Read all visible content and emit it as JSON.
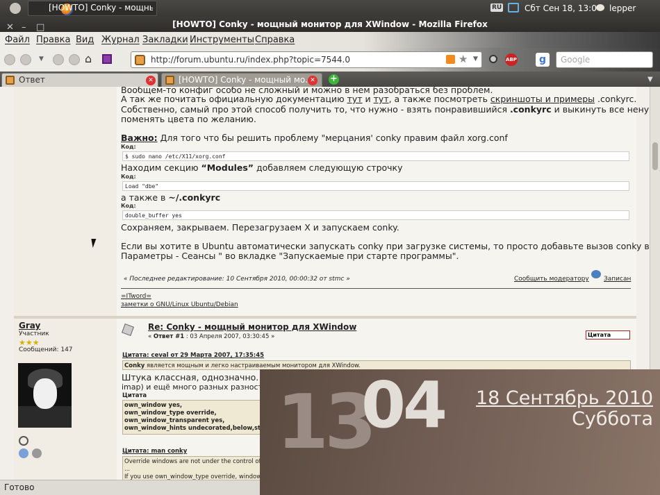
{
  "panel": {
    "task_title": "[HOWTO] Conky - мощны...",
    "keyboard": "RU",
    "clock": "Сбт Сен 18, 13:04",
    "user": "lepper"
  },
  "window": {
    "title": "[HOWTO] Conky - мощный монитор для XWindow - Mozilla Firefox"
  },
  "menu": [
    "Файл",
    "Правка",
    "Вид",
    "Журнал",
    "Закладки",
    "Инструменты",
    "Справка"
  ],
  "nav": {
    "url": "http://forum.ubuntu.ru/index.php?topic=7544.0",
    "search_placeholder": "Google",
    "abp": "ABP"
  },
  "tabs": [
    {
      "label": "Ответ"
    },
    {
      "label": "[HOWTO] Conky - мощный мо..."
    }
  ],
  "post1": {
    "line1": "Вообщем-то конфиг особо не сложный и можно в нем разобраться без проблем.",
    "line2a": "А так же почитать официальную документацию ",
    "link_tut1": "тут",
    "and": " и ",
    "link_tut2": "тут",
    "line2b": ", а также посмотреть ",
    "link_shots": "скриншоты и примеры",
    "line2c": " .conkyrc.",
    "line3a": " Собственно, самый про этой способ получить то, что нужно - взять понравившийся ",
    "line3b": ".conkyrc",
    "line3c": " и выкинуть все ненужное и",
    "line4": "поменять цвета по желанию.",
    "important": "Важно:",
    "line5": " Для того что бы решить проблему \"мерцания' conky правим файл xorg.conf",
    "code_label": "Код:",
    "code1": "$ sudo nano /etc/X11/xorg.conf",
    "line6a": "Находим секцию ",
    "line6b": "“Modules”",
    "line6c": " добавляем следующую строчку",
    "code2": "Load \"dbe\"",
    "line7a": "а также в ",
    "line7b": "~/.conkyrc",
    "code3": "double_buffer yes",
    "line8": "Сохраняем, закрываем. Перезагрузаем X  и запускаем conky.",
    "line9": "Если вы хотите в Ubuntu автоматически запускать conky при загрузке системы, то просто добавьте вызов conky в \"Система -",
    "line10": "Параметры - Сеансы \" во вкладке \"Запускаемые при старте программы\".",
    "edited": "« Последнее редактирование: 10 Сентября 2010, 00:00:32 от stmc »",
    "report": "Сообщить модератору",
    "logged": "Записан",
    "sig1": "=ITword=",
    "sig2": "заметки о GNU/Linux Ubuntu/Debian"
  },
  "post2": {
    "author": "Gray",
    "rank": "Участник",
    "posts": "Сообщений: 147",
    "title": "Re: Conky - мощный монитор для XWindow",
    "meta_a": "« ",
    "meta_b": "Ответ #1",
    "meta_c": " : 03 Апреля 2007, 03:30:45 »",
    "quote_btn": "Цитата",
    "q1_header": "Цитата: ceval от 29 Марта 2007, 17:35:45",
    "q1_a": "Conky",
    "q1_b": " является мощным и легко настраиваемым монитором для XWindow.",
    "text1": "Штука классная, однозначно. Мож",
    "text2": "imap) и ещё много разных разност",
    "q2_header": "Цитата",
    "q2_lines": [
      "own_window yes,",
      "own_window_type override,",
      "own_window_transparent yes,",
      "own_window_hints undecorated,below,stic"
    ],
    "q3_header": "Цитата: man conky",
    "q3_line1": "Override windows are not under the control of",
    "q3_line2": "...",
    "q3_line3": "If you use own_window_type override, window"
  },
  "status": "Готово",
  "conky": {
    "hours": "13",
    "minutes": "04",
    "date": "18 Сентябрь 2010",
    "weekday": "Суббота"
  }
}
